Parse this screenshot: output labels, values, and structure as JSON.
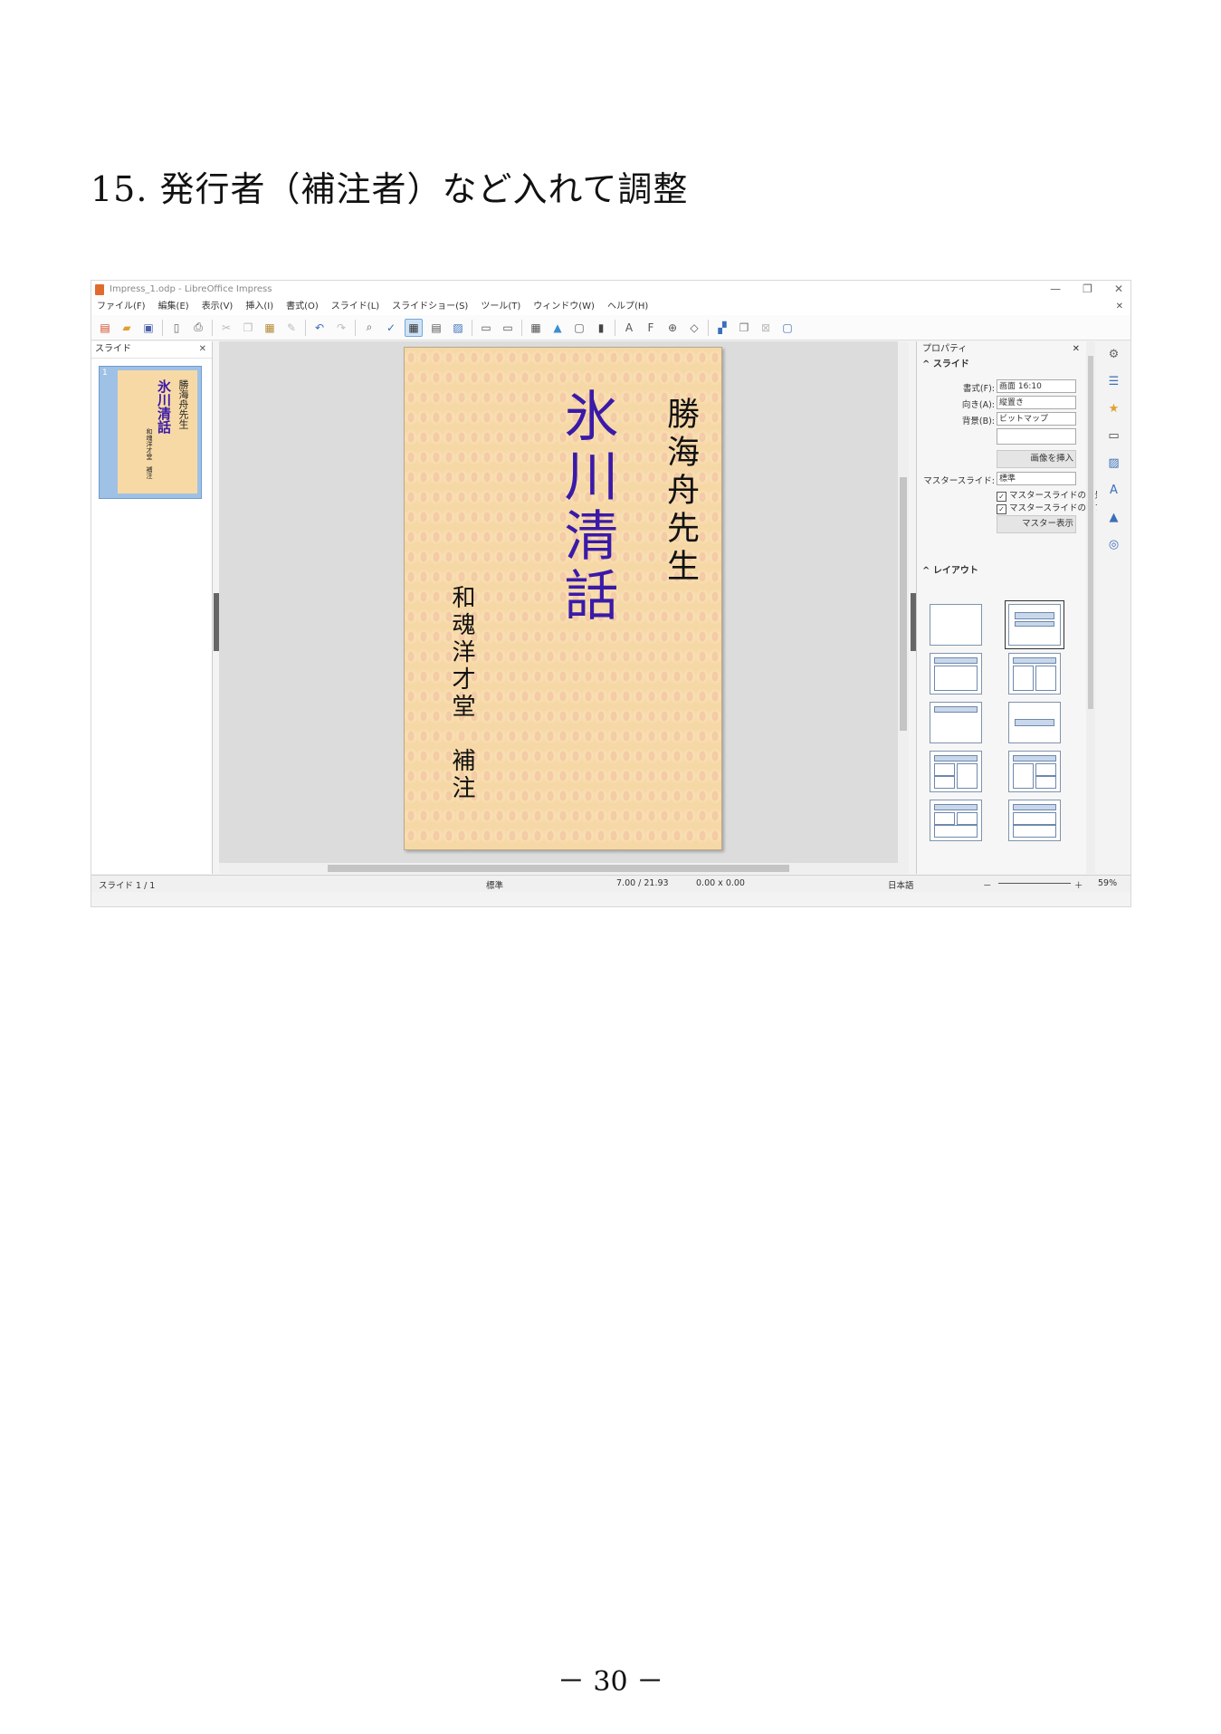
{
  "document": {
    "heading": "15. 発行者（補注者）など入れて調整",
    "page_number": "－ 30 －"
  },
  "app": {
    "window_title": "Impress_1.odp - LibreOffice Impress",
    "window_controls": {
      "minimize": "—",
      "restore": "❐",
      "close": "✕"
    },
    "menu": [
      "ファイル(F)",
      "編集(E)",
      "表示(V)",
      "挿入(I)",
      "書式(O)",
      "スライド(L)",
      "スライドショー(S)",
      "ツール(T)",
      "ウィンドウ(W)",
      "ヘルプ(H)"
    ],
    "doc_close": "✕",
    "slides_pane": {
      "title": "スライド",
      "close": "✕",
      "thumb_number": "1"
    },
    "slide": {
      "author": "勝海舟先生",
      "title": "氷川清話",
      "publisher": "和魂洋才堂　補注",
      "title_color": "#3a1aa8"
    },
    "sidebar": {
      "header": "プロパティ",
      "close": "✕",
      "slide_section": "スライド",
      "format_label": "書式(F):",
      "format_value": "画面 16:10",
      "orientation_label": "向き(A):",
      "orientation_value": "縦置き",
      "background_label": "背景(B):",
      "background_value": "ビットマップ",
      "insert_image_button": "画像を挿入",
      "master_slide_label": "マスタースライド:",
      "master_slide_value": "標準",
      "master_check_1": "マスタースライドの背景",
      "master_check_2": "マスタースライドのオブジェクト",
      "master_view_button": "マスター表示",
      "layout_section": "レイアウト"
    },
    "statusbar": {
      "slide_count": "スライド 1 / 1",
      "master": "標準",
      "position": "7.00 / 21.93",
      "size": "0.00 x 0.00",
      "language": "日本語",
      "zoom_minus": "－",
      "zoom_plus": "＋",
      "zoom": "59%"
    }
  }
}
